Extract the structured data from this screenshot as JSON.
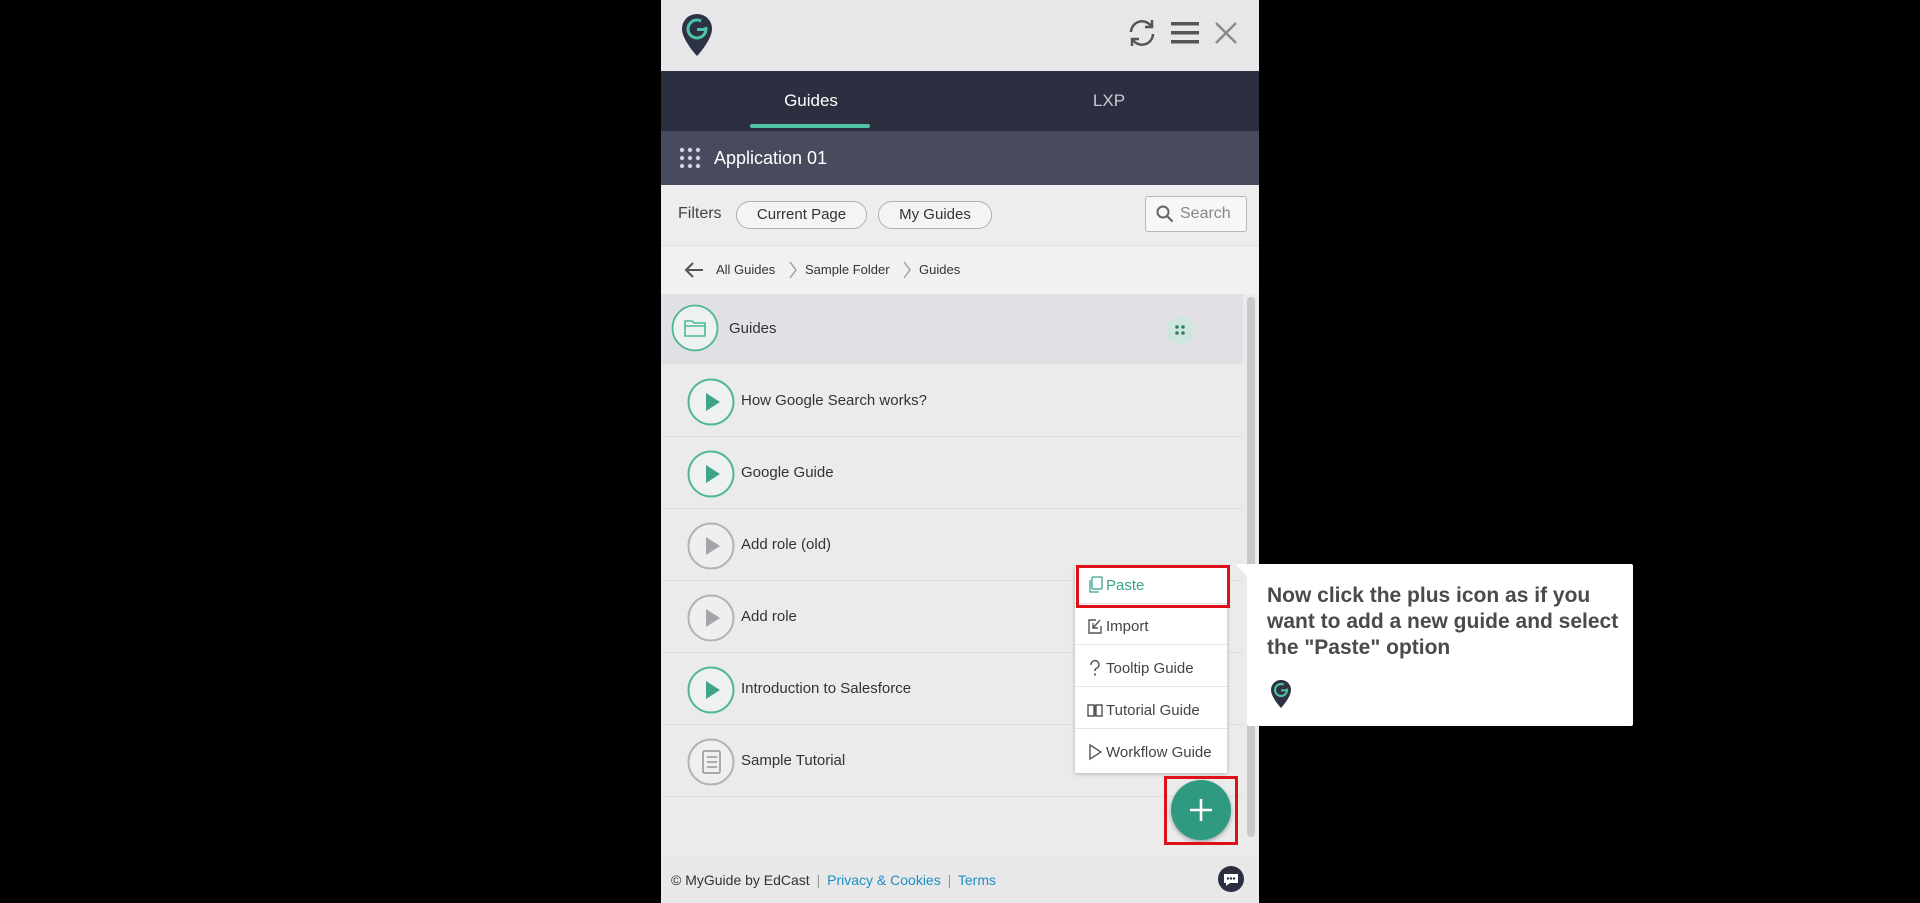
{
  "brand": {
    "accent": "#4fc3a6",
    "dark": "#2c2f3f",
    "highlight": "#e0101b"
  },
  "header": {
    "logo": "myguide-logo",
    "icons": [
      "refresh-icon",
      "menu-icon",
      "close-icon"
    ]
  },
  "tabs": [
    {
      "label": "Guides",
      "active": true
    },
    {
      "label": "LXP",
      "active": false
    }
  ],
  "app": {
    "title": "Application 01"
  },
  "filters": {
    "label": "Filters",
    "chips": [
      "Current Page",
      "My Guides"
    ],
    "search_placeholder": "Search"
  },
  "breadcrumb": [
    "All Guides",
    "Sample Folder",
    "Guides"
  ],
  "folder": {
    "label": "Guides"
  },
  "guides": [
    {
      "label": "How Google Search works?",
      "icon": "play-active"
    },
    {
      "label": "Google Guide",
      "icon": "play-active"
    },
    {
      "label": "Add role (old)",
      "icon": "play-inactive"
    },
    {
      "label": "Add role",
      "icon": "play-inactive"
    },
    {
      "label": "Introduction to Salesforce",
      "icon": "play-active"
    },
    {
      "label": "Sample Tutorial",
      "icon": "tutorial"
    }
  ],
  "menu": [
    {
      "label": "Paste",
      "icon": "paste-icon"
    },
    {
      "label": "Import",
      "icon": "import-icon"
    },
    {
      "label": "Tooltip Guide",
      "icon": "question-icon"
    },
    {
      "label": "Tutorial Guide",
      "icon": "book-icon"
    },
    {
      "label": "Workflow Guide",
      "icon": "play-outline-icon"
    }
  ],
  "footer": {
    "copyright": "© MyGuide by EdCast",
    "sep": "|",
    "privacy": "Privacy & Cookies",
    "terms": "Terms"
  },
  "tooltip": {
    "text": "Now click the plus icon as if you want to add a new guide and select the \"Paste\" option"
  }
}
